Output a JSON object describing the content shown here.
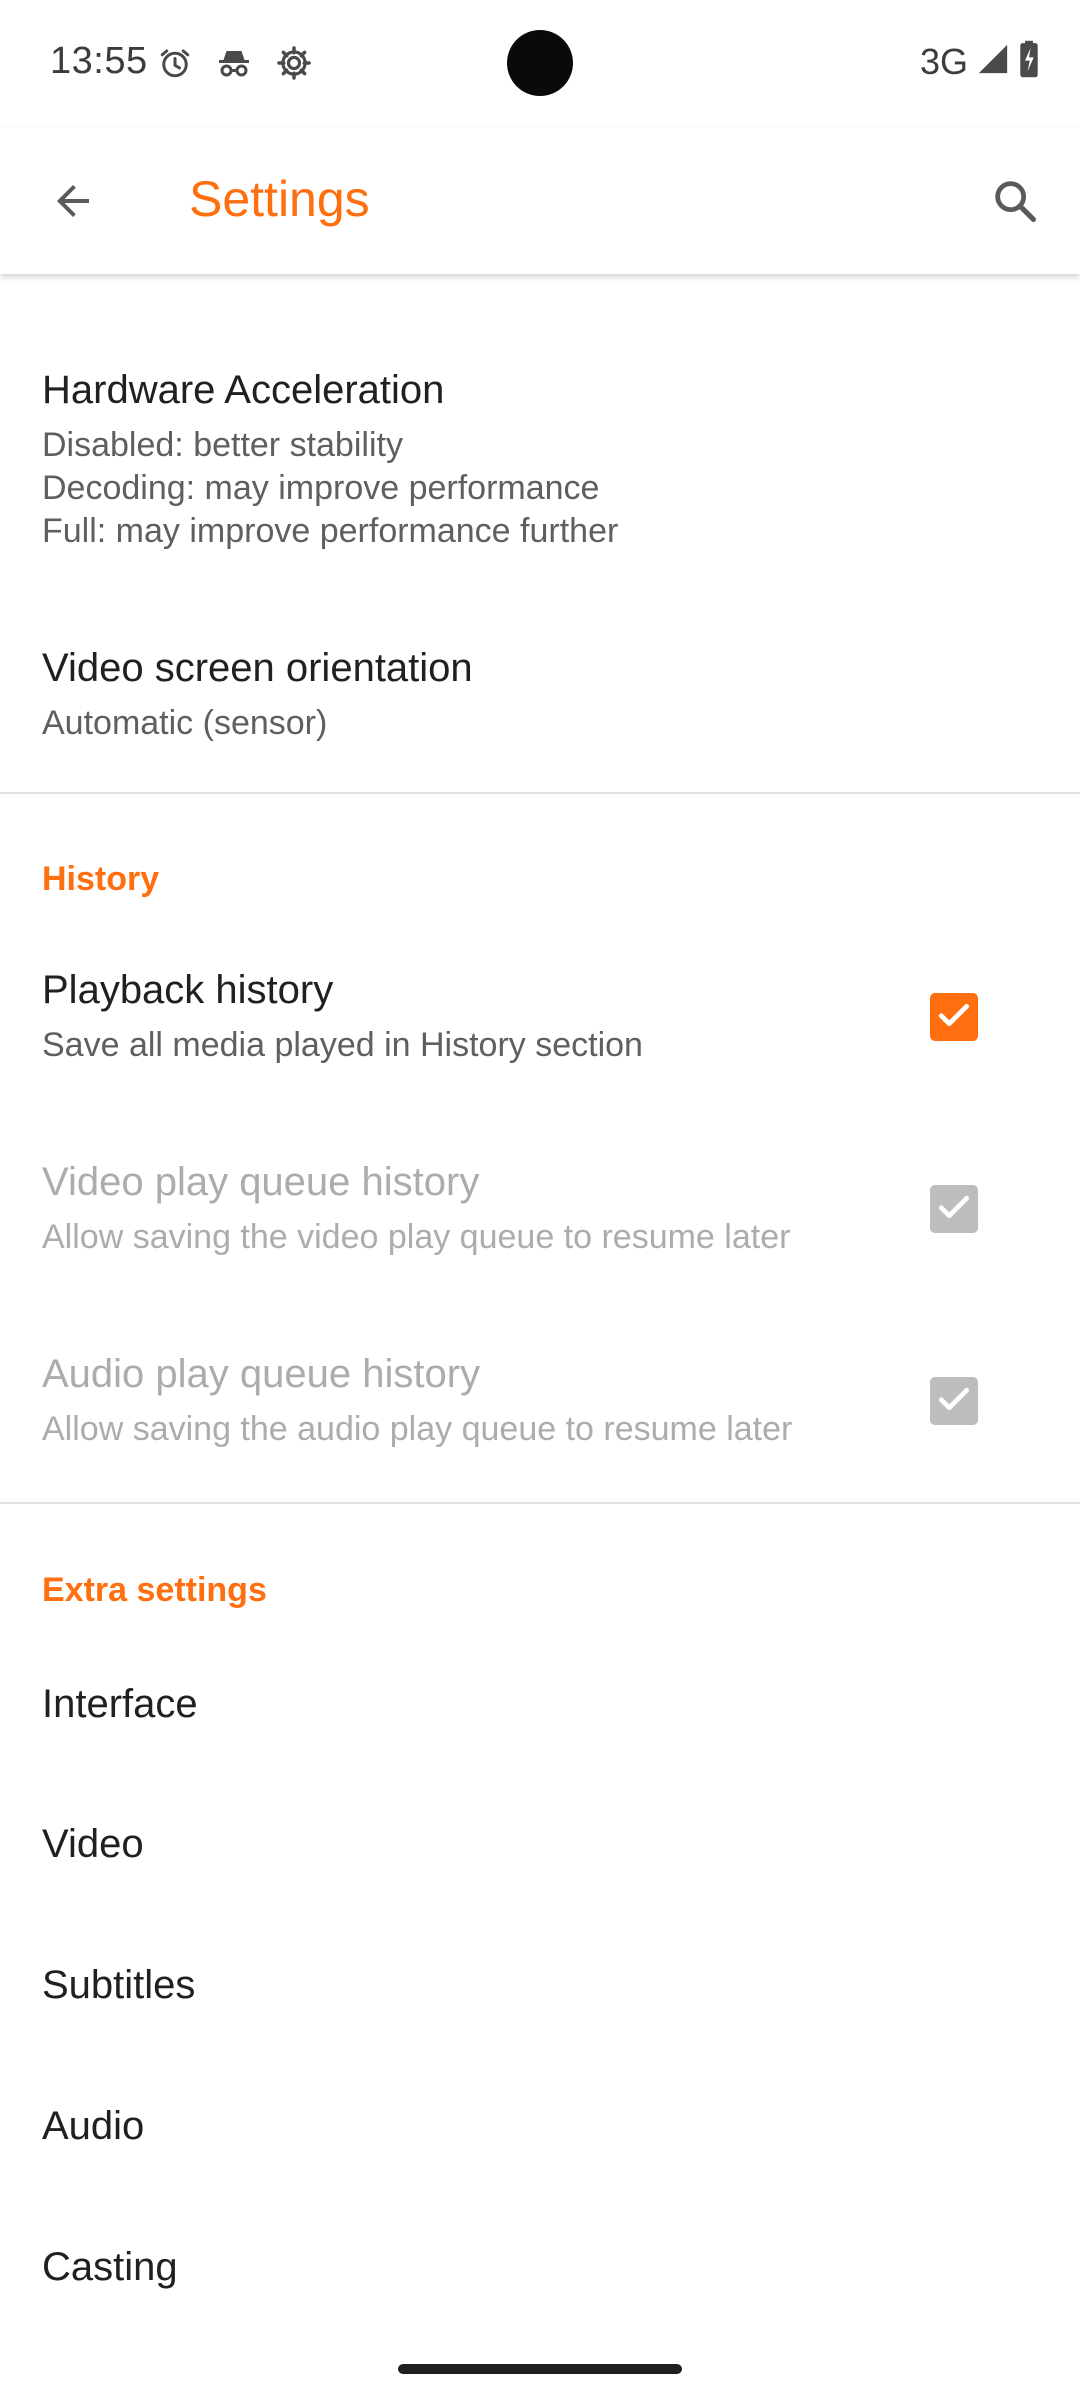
{
  "status_bar": {
    "time": "13:55",
    "network": "3G",
    "icons": [
      "alarm-icon",
      "incognito-icon",
      "settings-gear-icon",
      "signal-icon",
      "battery-charging-icon"
    ]
  },
  "app_bar": {
    "title": "Settings",
    "back_icon": "arrow-back-icon",
    "search_icon": "search-icon"
  },
  "colors": {
    "accent": "#ff6f0f",
    "text_primary": "#202020",
    "text_secondary": "#5f5f5f",
    "text_disabled": "#acacac"
  },
  "video_prefs": {
    "hardware_acceleration": {
      "title": "Hardware Acceleration",
      "summary": "Disabled: better stability\nDecoding: may improve performance\nFull: may improve performance further"
    },
    "screen_orientation": {
      "title": "Video screen orientation",
      "summary": "Automatic (sensor)"
    }
  },
  "history": {
    "header": "History",
    "items": [
      {
        "title": "Playback history",
        "summary": "Save all media played in History section",
        "checked": true,
        "enabled": true
      },
      {
        "title": "Video play queue history",
        "summary": "Allow saving the video play queue to resume later",
        "checked": true,
        "enabled": false
      },
      {
        "title": "Audio play queue history",
        "summary": "Allow saving the audio play queue to resume later",
        "checked": true,
        "enabled": false
      }
    ]
  },
  "extra_settings": {
    "header": "Extra settings",
    "items": [
      "Interface",
      "Video",
      "Subtitles",
      "Audio",
      "Casting"
    ]
  }
}
